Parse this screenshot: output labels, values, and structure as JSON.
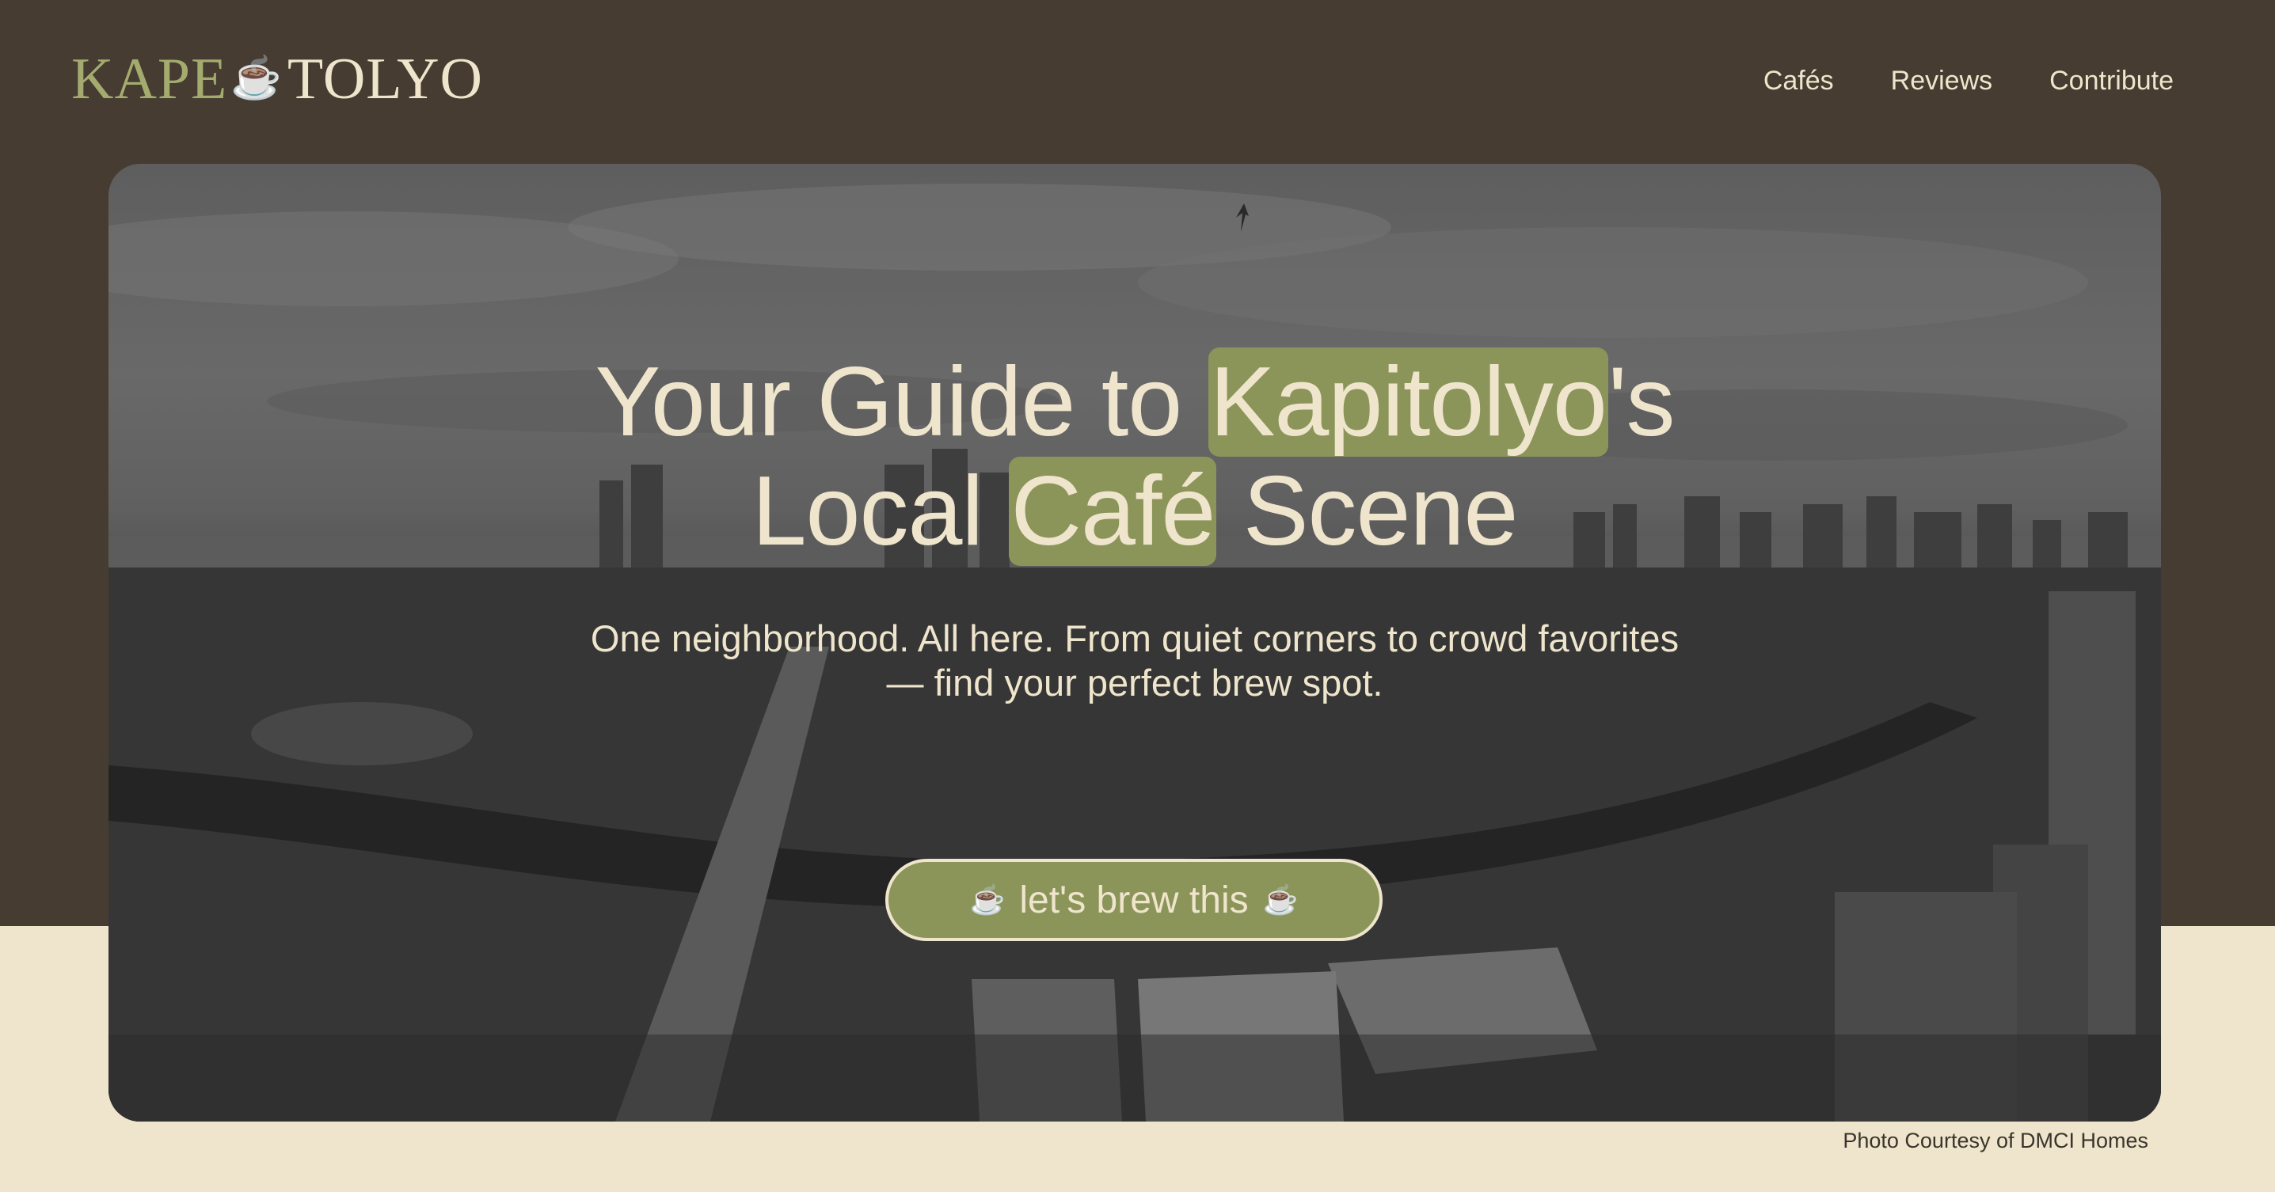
{
  "brand": {
    "logo_part1": "KAPE",
    "logo_icon": "☕",
    "logo_part2": "TOLYO",
    "icon_name": "coffee-cup-icon"
  },
  "nav": {
    "items": [
      "Cafés",
      "Reviews",
      "Contribute"
    ]
  },
  "hero": {
    "title_pre": "Your Guide to ",
    "title_highlight1": "Kapitolyo",
    "title_mid": "'s",
    "title_line2_pre": "Local ",
    "title_highlight2": "Café",
    "title_line2_post": " Scene",
    "subtitle_line1": "One neighborhood. All here. From quiet corners to crowd favorites",
    "subtitle_line2": "— find your perfect brew spot.",
    "cta_label": "let's brew this",
    "cta_icon": "☕",
    "image_description_icon": "city-skyline-photo"
  },
  "credit": "Photo Courtesy of DMCI Homes",
  "colors": {
    "header_bg": "#463c32",
    "page_bg": "#efe5cc",
    "accent_green": "#8b955a",
    "logo_green": "#a4ab6e",
    "cream_text": "#efe5cc"
  }
}
